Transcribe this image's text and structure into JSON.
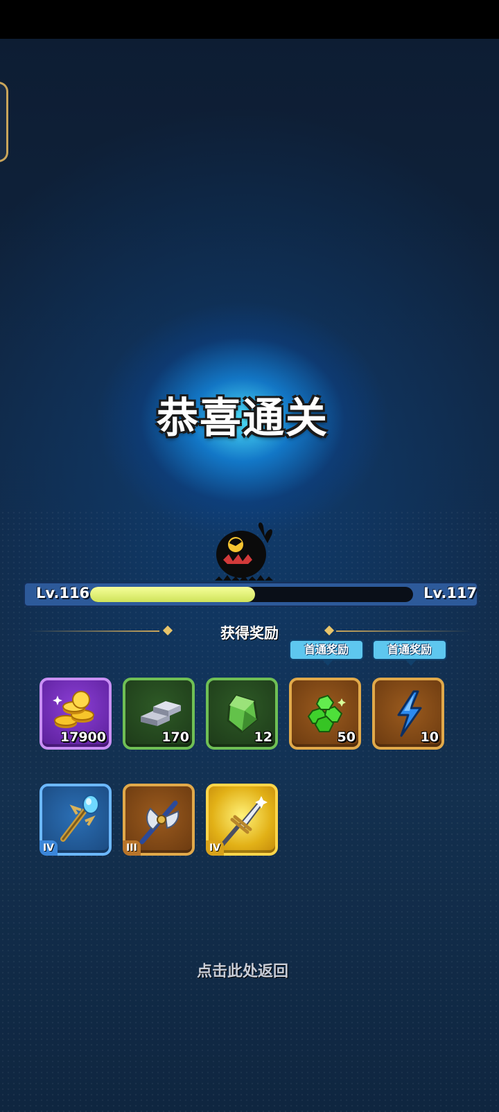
{
  "title": "恭喜通关",
  "level": {
    "current_label": "Lv.116",
    "next_label": "Lv.117",
    "progress_fraction": 0.51
  },
  "rewards_heading": "获得奖励",
  "first_clear_label": "首通奖励",
  "rewards": [
    {
      "icon": "gold-coins-icon",
      "count": "17900",
      "frame": "purple"
    },
    {
      "icon": "iron-ingot-icon",
      "count": "170",
      "frame": "green"
    },
    {
      "icon": "green-ore-icon",
      "count": "12",
      "frame": "green"
    },
    {
      "icon": "emerald-gems-icon",
      "count": "50",
      "frame": "brown",
      "first_clear": true
    },
    {
      "icon": "lightning-energy-icon",
      "count": "10",
      "frame": "brown",
      "first_clear": true
    }
  ],
  "equipment": [
    {
      "icon": "crystal-staff-icon",
      "tier": "IV",
      "frame": "blue"
    },
    {
      "icon": "battle-axe-icon",
      "tier": "III",
      "frame": "brown"
    },
    {
      "icon": "golden-sword-icon",
      "tier": "IV",
      "frame": "gold"
    }
  ],
  "return_hint": "点击此处返回",
  "colors": {
    "glow": "#50e6ff",
    "progress": "#e8f57a",
    "accent_gold": "#c9a55a",
    "tag_blue": "#5ec7ef"
  }
}
